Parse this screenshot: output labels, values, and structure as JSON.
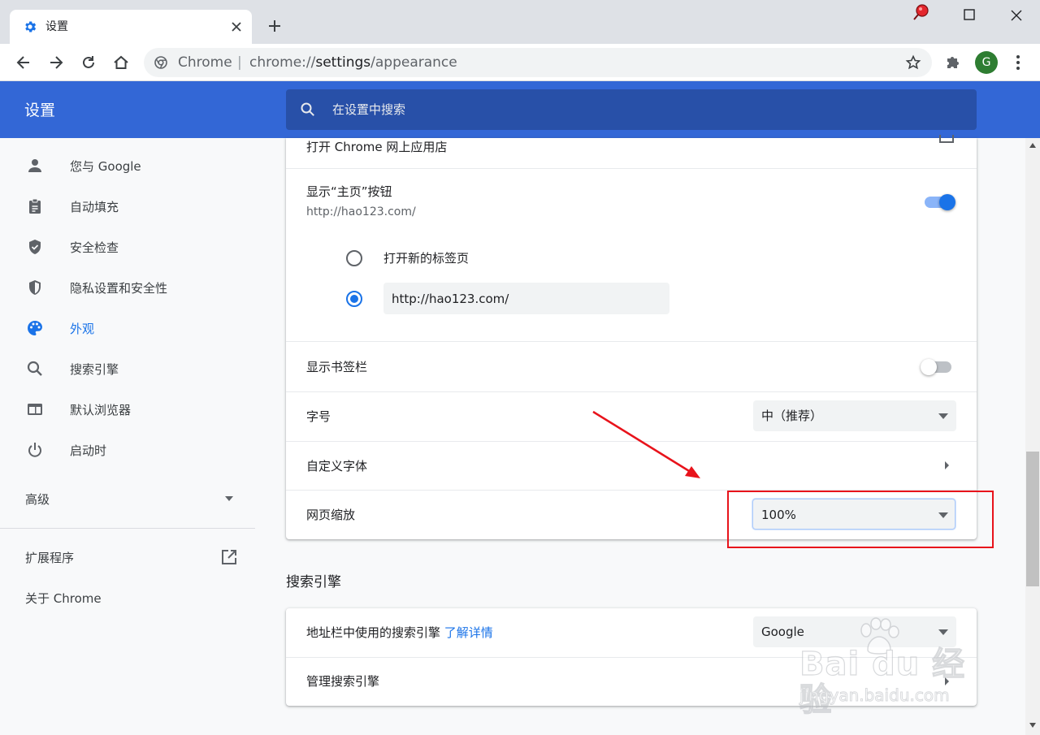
{
  "tab": {
    "title": "设置",
    "close_icon": "close-icon",
    "new_tab_icon": "plus-icon"
  },
  "toolbar": {
    "omnibox_scheme": "Chrome",
    "omnibox_separator": "|",
    "url_prefix": "chrome://",
    "url_host": "settings",
    "url_path": "/appearance",
    "avatar_letter": "G"
  },
  "header": {
    "title": "设置",
    "search_placeholder": "在设置中搜索"
  },
  "sidebar": {
    "items": [
      {
        "label": "您与 Google",
        "icon": "person-icon"
      },
      {
        "label": "自动填充",
        "icon": "clipboard-icon"
      },
      {
        "label": "安全检查",
        "icon": "shield-check-icon"
      },
      {
        "label": "隐私设置和安全性",
        "icon": "privacy-shield-icon"
      },
      {
        "label": "外观",
        "icon": "palette-icon",
        "active": true
      },
      {
        "label": "搜索引擎",
        "icon": "search-icon"
      },
      {
        "label": "默认浏览器",
        "icon": "browser-window-icon"
      },
      {
        "label": "启动时",
        "icon": "power-icon"
      }
    ],
    "advanced": "高级",
    "extensions": "扩展程序",
    "about": "关于 Chrome"
  },
  "appearance": {
    "webstore_row": "打开 Chrome 网上应用店",
    "home_button": {
      "label": "显示“主页”按钮",
      "sub": "http://hao123.com/",
      "enabled": true
    },
    "home_options": {
      "new_tab": "打开新的标签页",
      "custom_url": "http://hao123.com/",
      "selected": "custom_url"
    },
    "bookmarks_bar": {
      "label": "显示书签栏",
      "enabled": false
    },
    "font_size": {
      "label": "字号",
      "value": "中（推荐）"
    },
    "custom_fonts": {
      "label": "自定义字体"
    },
    "page_zoom": {
      "label": "网页缩放",
      "value": "100%"
    }
  },
  "search_engine_section": {
    "title": "搜索引擎",
    "engine_row": {
      "label": "地址栏中使用的搜索引擎",
      "link": "了解详情",
      "value": "Google"
    },
    "manage_row": {
      "label": "管理搜索引擎"
    }
  },
  "watermark": {
    "brand": "Bai du 经验",
    "sub": "jingyan.baidu.com"
  },
  "colors": {
    "header_blue": "#3367d6",
    "accent": "#1a73e8",
    "annotation_red": "#e8131b"
  }
}
